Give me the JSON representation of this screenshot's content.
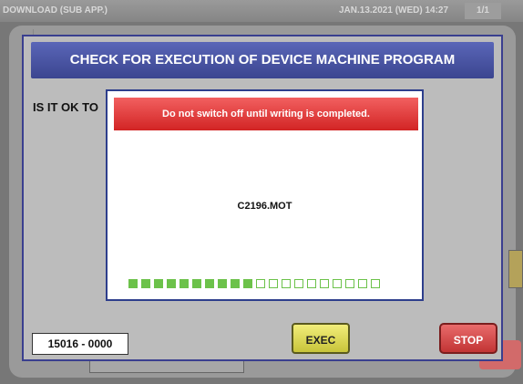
{
  "statusbar": {
    "app_title": "DOWNLOAD (SUB APP.)",
    "datetime": "JAN.13.2021 (WED)  14:27",
    "page": "1/1"
  },
  "dialog": {
    "title": "CHECK FOR EXECUTION OF DEVICE MACHINE PROGRAM",
    "question": "IS IT OK TO",
    "code": "15016 - 0000",
    "exec_label": "EXEC",
    "stop_label": "STOP"
  },
  "progress": {
    "warning": "Do not switch off until writing is completed.",
    "filename": "C2196.MOT",
    "segments_total": 20,
    "segments_done": 10,
    "fill_color": "#6cc24a"
  }
}
